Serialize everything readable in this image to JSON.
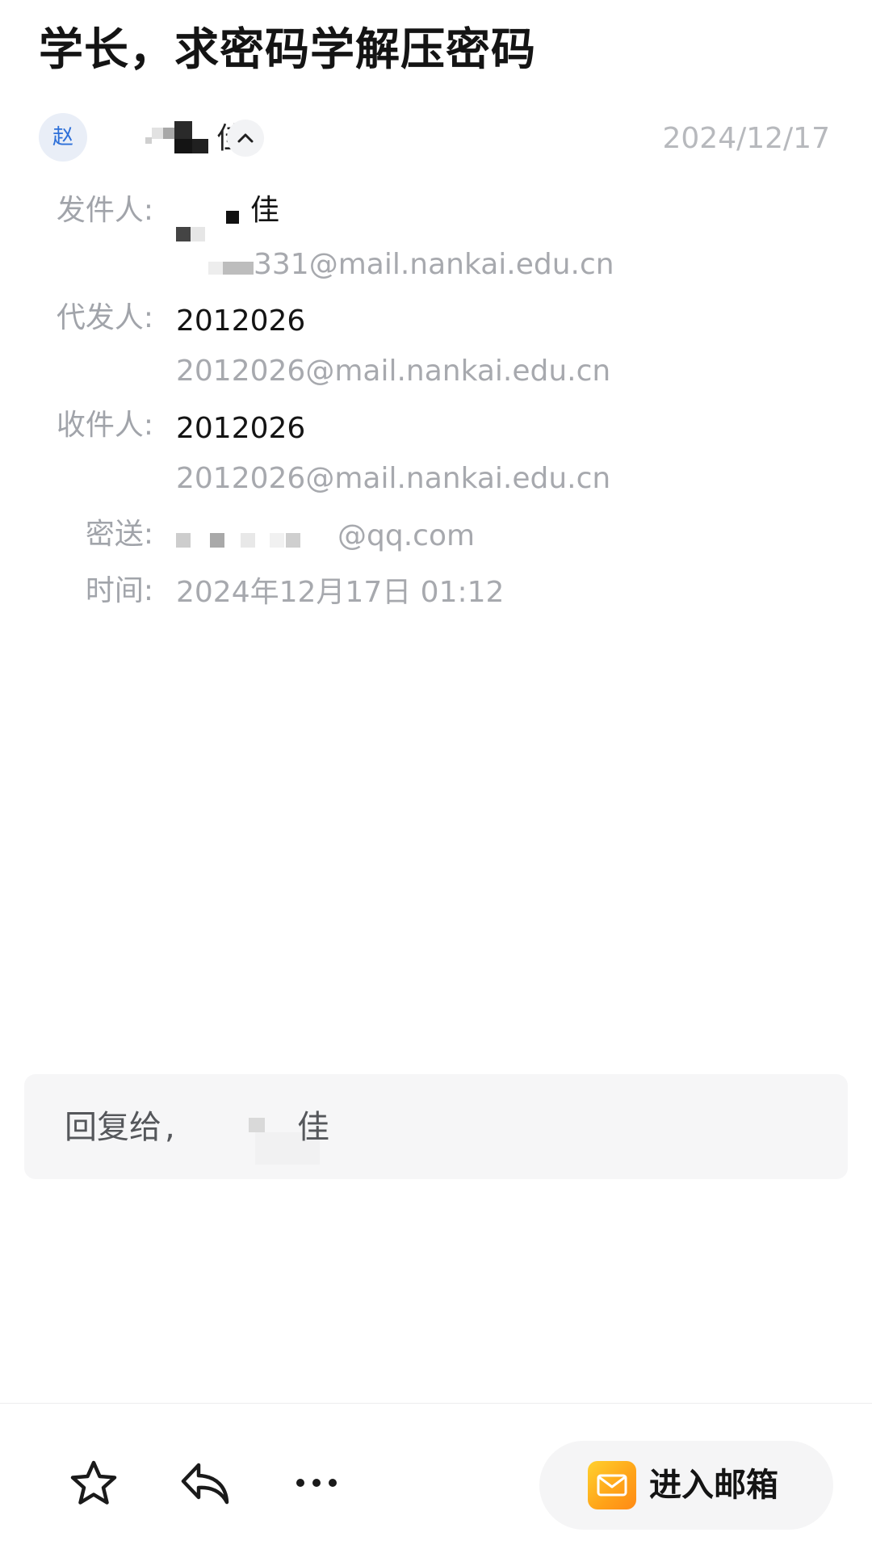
{
  "email": {
    "subject": "学长，求密码学解压密码",
    "date_short": "2024/12/17"
  },
  "sender_row": {
    "avatar_text": "赵",
    "name_visible": "佳"
  },
  "details": {
    "from": {
      "label": "发件人:",
      "name_visible": "佳",
      "address_visible": "331@mail.nankai.edu.cn"
    },
    "on_behalf": {
      "label": "代发人:",
      "name": "2012026",
      "address": "2012026@mail.nankai.edu.cn"
    },
    "to": {
      "label": "收件人:",
      "name": "2012026",
      "address": "2012026@mail.nankai.edu.cn"
    },
    "bcc": {
      "label": "密送:",
      "address_visible": "@qq.com"
    },
    "time": {
      "label": "时间:",
      "value": "2024年12月17日 01:12"
    }
  },
  "reply": {
    "prefix": "回复给",
    "name_visible": "佳"
  },
  "toolbar": {
    "icons": [
      "star-icon",
      "reply-icon",
      "more-icon"
    ],
    "enter_mailbox_label": "进入邮箱",
    "accent_color": "#ffa218"
  }
}
